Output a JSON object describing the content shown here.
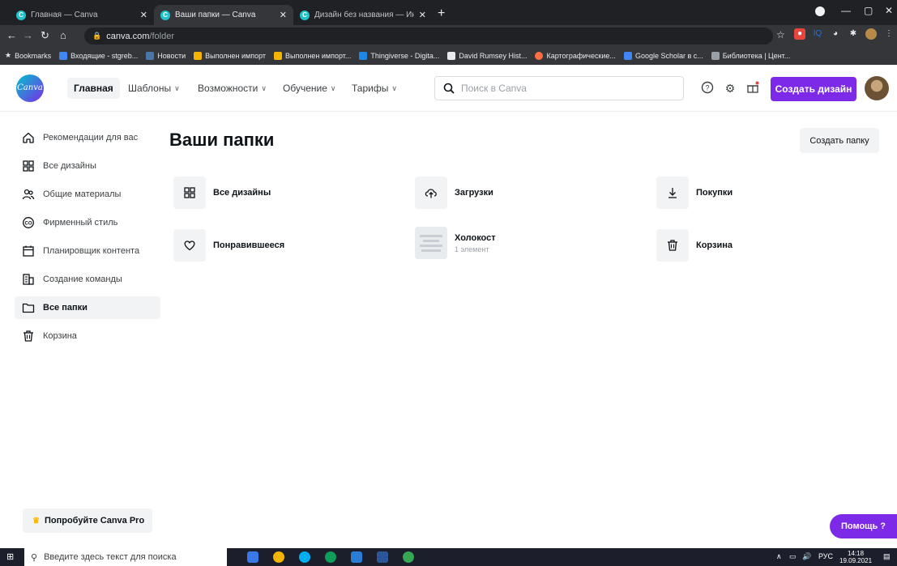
{
  "browser": {
    "tabs": [
      {
        "title": "Главная — Canva"
      },
      {
        "title": "Ваши папки — Canva"
      },
      {
        "title": "Дизайн без названия — Инфогр"
      }
    ],
    "url_host": "canva.com",
    "url_path": "/folder",
    "bookmarks": [
      {
        "label": "Bookmarks",
        "color": "#f1f3f4"
      },
      {
        "label": "Входящие - stgreb...",
        "color": "#4285f4"
      },
      {
        "label": "Новости",
        "color": "#4a76a8"
      },
      {
        "label": "Выполнен импорт",
        "color": "#f4b400"
      },
      {
        "label": "Выполнен импорт...",
        "color": "#f4b400"
      },
      {
        "label": "Thingiverse - Digita...",
        "color": "#1e88e5"
      },
      {
        "label": "David Rumsey Hist...",
        "color": "#e8eaed"
      },
      {
        "label": "Картографические...",
        "color": "#ff7043"
      },
      {
        "label": "Google Scholar в с...",
        "color": "#4285f4"
      },
      {
        "label": "Библиотека | Цент...",
        "color": "#9aa0a6"
      }
    ]
  },
  "header": {
    "logo": "Canva",
    "nav": [
      {
        "label": "Главная"
      },
      {
        "label": "Шаблоны"
      },
      {
        "label": "Возможности"
      },
      {
        "label": "Обучение"
      },
      {
        "label": "Тарифы"
      }
    ],
    "search_placeholder": "Поиск в Canva",
    "create_button": "Создать дизайн"
  },
  "sidebar": {
    "items": [
      {
        "label": "Рекомендации для вас",
        "icon": "home-icon"
      },
      {
        "label": "Все дизайны",
        "icon": "grid-icon"
      },
      {
        "label": "Общие материалы",
        "icon": "people-icon"
      },
      {
        "label": "Фирменный стиль",
        "icon": "brand-icon"
      },
      {
        "label": "Планировщик контента",
        "icon": "calendar-icon"
      },
      {
        "label": "Создание команды",
        "icon": "team-icon"
      },
      {
        "label": "Все папки",
        "icon": "folder-icon"
      },
      {
        "label": "Корзина",
        "icon": "trash-icon"
      }
    ],
    "try_pro": "Попробуйте Canva Pro"
  },
  "main": {
    "title": "Ваши папки",
    "create_folder": "Создать папку",
    "folders": [
      {
        "name": "Все дизайны",
        "icon": "grid-icon"
      },
      {
        "name": "Загрузки",
        "icon": "cloud-upload-icon"
      },
      {
        "name": "Покупки",
        "icon": "download-icon"
      },
      {
        "name": "Понравившееся",
        "icon": "heart-icon"
      },
      {
        "name": "Холокост",
        "count": "1 элемент",
        "icon": "folder-thumbnail"
      },
      {
        "name": "Корзина",
        "icon": "trash-icon"
      }
    ]
  },
  "help_button": "Помощь ?",
  "taskbar": {
    "search_placeholder": "Введите здесь текст для поиска",
    "lang": "РУС",
    "time": "14:18",
    "date": "19.09.2021"
  }
}
